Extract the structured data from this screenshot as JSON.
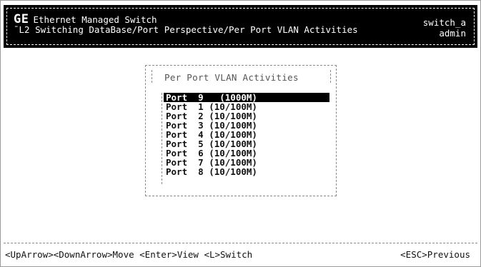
{
  "header": {
    "logo": "GE",
    "product": "Ethernet Managed Switch",
    "breadcrumb": "L2 Switching DataBase/Port Perspective/Per Port VLAN Activities",
    "hostname": "switch_a",
    "user": "admin"
  },
  "menu": {
    "title": "Per Port VLAN Activities",
    "items": [
      "Port  9   (1000M)",
      "Port  1 (10/100M)",
      "Port  2 (10/100M)",
      "Port  3 (10/100M)",
      "Port  4 (10/100M)",
      "Port  5 (10/100M)",
      "Port  6 (10/100M)",
      "Port  7 (10/100M)",
      "Port  8 (10/100M)"
    ],
    "selected_index": 0
  },
  "footer": {
    "keys": "<UpArrow><DownArrow>Move <Enter>View <L>Switch",
    "previous": "<ESC>Previous"
  },
  "colors": {
    "background": "#ffffff",
    "header_background": "#000000",
    "highlight": "#000000"
  }
}
